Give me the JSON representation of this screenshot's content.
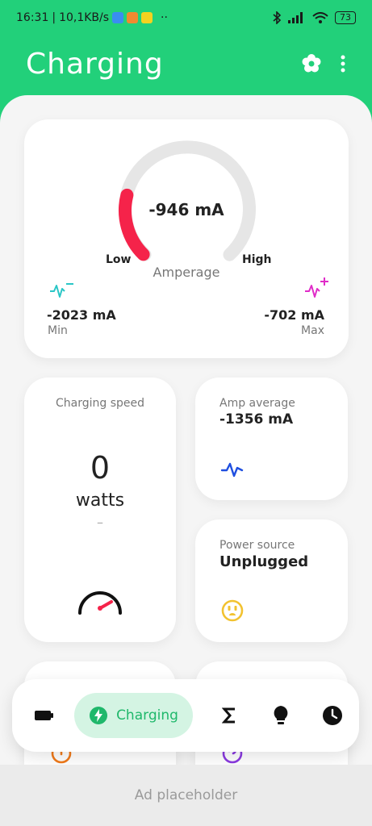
{
  "status_bar": {
    "time": "16:31",
    "network_speed": "10,1KB/s",
    "battery_level": "73",
    "overflow": "··"
  },
  "app_bar": {
    "title": "Charging"
  },
  "gauge_card": {
    "value": "-946 mA",
    "caption": "Amperage",
    "low_label": "Low",
    "high_label": "High",
    "min_value": "-2023 mA",
    "min_label": "Min",
    "max_value": "-702 mA",
    "max_label": "Max",
    "level_fraction": 0.22,
    "track_color": "#e6e6e6",
    "fill_color": "#f5234a"
  },
  "speed_card": {
    "title": "Charging speed",
    "value": "0",
    "unit": "watts",
    "sub": "–"
  },
  "amp_card": {
    "title": "Amp average",
    "value": "-1356 mA"
  },
  "power_card": {
    "title": "Power source",
    "value": "Unplugged"
  },
  "nav": {
    "active_label": "Charging",
    "items": [
      "battery-icon",
      "charging-bolt-icon",
      "sigma-icon",
      "bulb-icon",
      "clock-icon"
    ]
  },
  "ad": {
    "label": "Ad placeholder"
  },
  "colors": {
    "brand": "#22d07a",
    "accent_cyan": "#2ac6c6",
    "accent_magenta": "#e02cc8",
    "accent_blue": "#1f4fe0",
    "warning_yellow": "#f2c230"
  }
}
